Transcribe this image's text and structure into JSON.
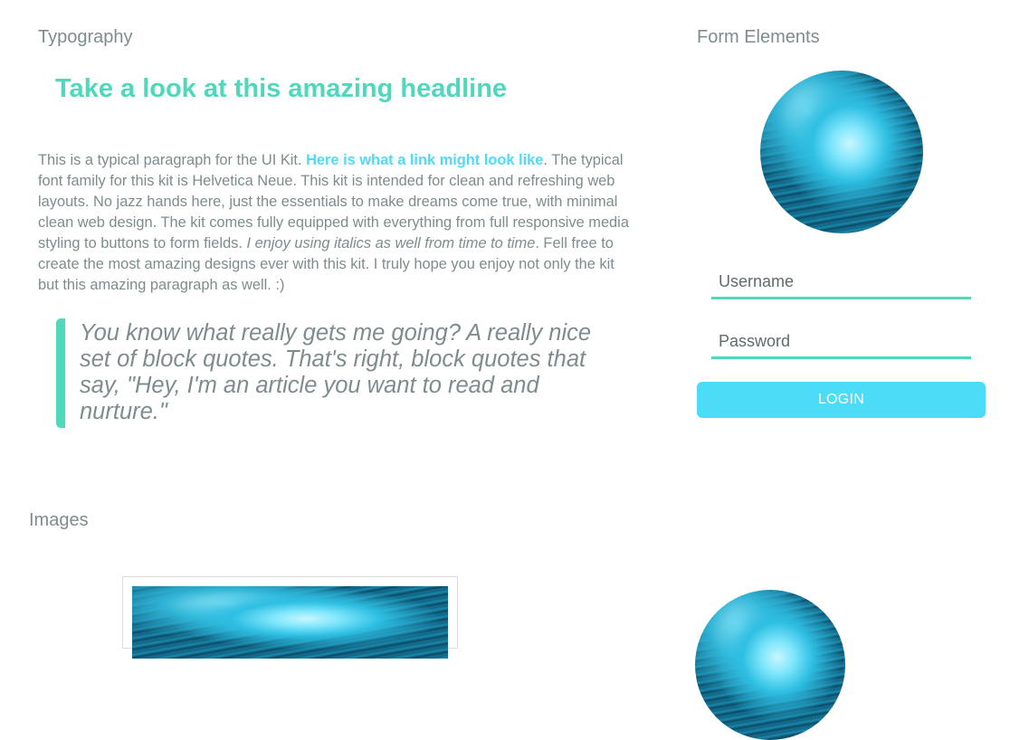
{
  "typography": {
    "section_title": "Typography",
    "headline": "Take a look at this amazing headline",
    "paragraph": {
      "intro": "This is a typical paragraph for the UI Kit. ",
      "link_text": "Here is what a link might look like",
      "middle": ". The typical font family for this kit is Helvetica Neue. This kit is intended for clean and refreshing web layouts. No jazz hands here, just the essentials to make dreams come true, with minimal clean web design. The kit comes fully equipped with everything from full responsive media styling to buttons to form fields. ",
      "italic": "I enjoy using italics as well from time to time",
      "end": ". Fell free to create the most amazing designs ever with this kit. I truly hope you enjoy not only the kit but this amazing paragraph as well. :)"
    },
    "blockquote": "You know what really gets me going? A really nice set of block quotes. That's right, block quotes that say, \"Hey, I'm an article you want to read and nurture.\""
  },
  "form": {
    "section_title": "Form Elements",
    "username_placeholder": "Username",
    "password_placeholder": "Password",
    "login_label": "LOGIN"
  },
  "images": {
    "section_title": "Images"
  },
  "colors": {
    "accent_green": "#4fd8bb",
    "accent_blue": "#4ddcf7",
    "text_gray": "#7f8c8d"
  }
}
